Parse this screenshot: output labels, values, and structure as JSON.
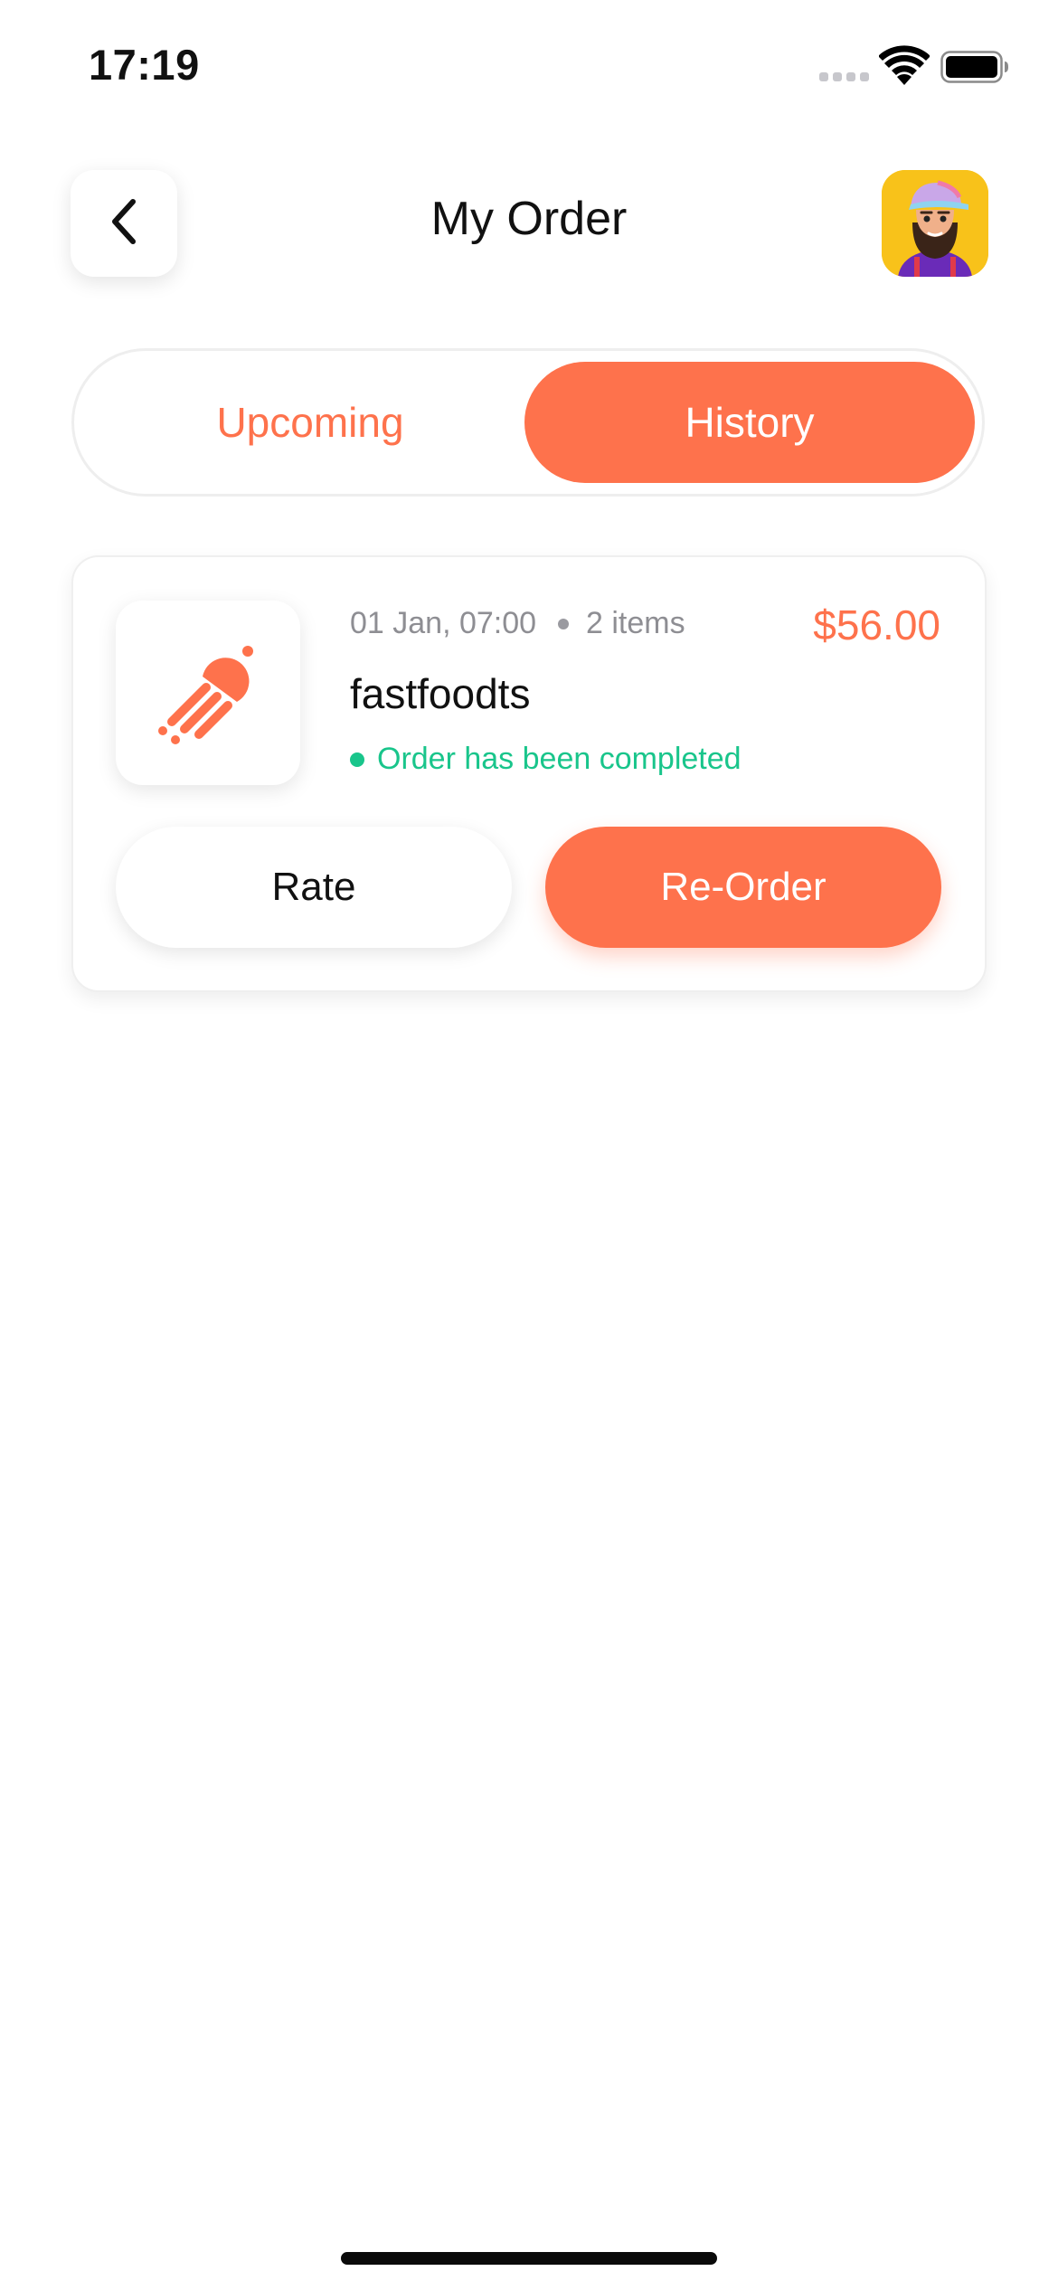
{
  "status_bar": {
    "time": "17:19"
  },
  "header": {
    "title": "My Order",
    "back_icon": "chevron-left-icon",
    "avatar_icon": "user-avatar"
  },
  "tabs": [
    {
      "label": "Upcoming",
      "active": false
    },
    {
      "label": "History",
      "active": true
    }
  ],
  "orders": [
    {
      "date": "01 Jan, 07:00",
      "items": "2 items",
      "price": "$56.00",
      "restaurant": "fastfoodts",
      "status": "Order has been completed",
      "logo_icon": "jellyfish-logo-icon",
      "rate_label": "Rate",
      "reorder_label": "Re-Order"
    }
  ],
  "colors": {
    "accent": "#fe724c",
    "success": "#19c58b",
    "muted_text": "#8e8e93"
  }
}
